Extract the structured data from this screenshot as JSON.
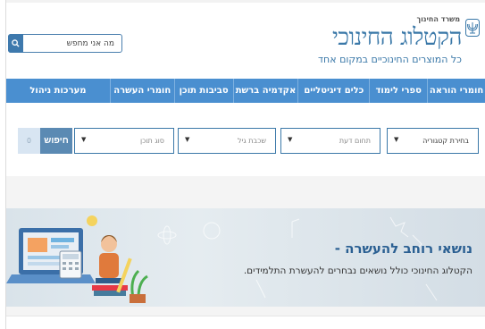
{
  "header": {
    "ministry": "משרד החינוך",
    "title": "הקטלוג החינוכי",
    "subtitle": "כל המוצרים החינוכיים במקום אחד",
    "search": {
      "placeholder": "מה אני מחפש",
      "icon": "search-icon"
    }
  },
  "nav": {
    "items": [
      {
        "label": "חומרי הוראה"
      },
      {
        "label": "ספרי לימוד"
      },
      {
        "label": "כלים דיגיטליים"
      },
      {
        "label": "אקדמיה ברשת"
      },
      {
        "label": "סביבות תוכן"
      },
      {
        "label": "חומרי העשרה"
      },
      {
        "label": "מערכות ניהול"
      }
    ],
    "color": "#4a8fd0"
  },
  "filters": {
    "category": "בחירת קטגוריה",
    "field": "תחום דעת",
    "age": "שכבת גיל",
    "content_type": "סוג תוכן",
    "search_button": "חיפוש",
    "reset_button": "0"
  },
  "banner": {
    "title": "נושאי רוחב להעשרה -",
    "text": "הקטלוג החינוכי כולל נושאים נבחרים להעשרת התלמידים."
  }
}
